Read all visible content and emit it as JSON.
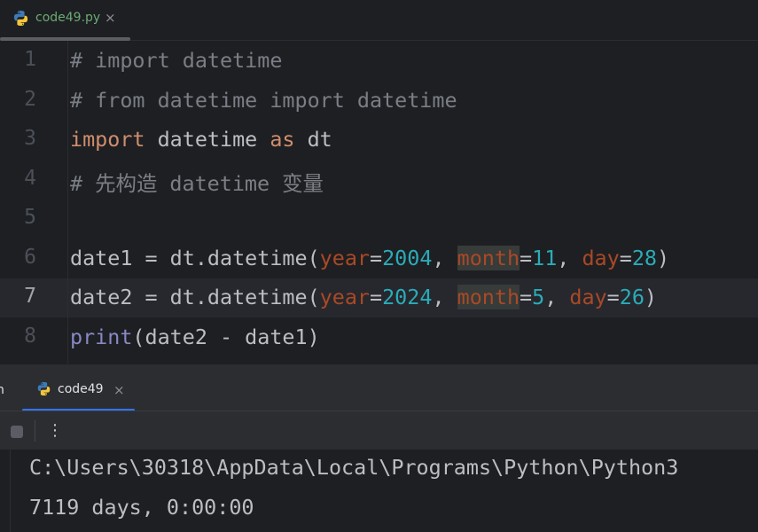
{
  "editor": {
    "tab": {
      "filename": "code49.py",
      "close": "×"
    },
    "lines": [
      {
        "num": "1",
        "tokens": [
          {
            "t": "# import datetime",
            "c": "comment"
          }
        ]
      },
      {
        "num": "2",
        "tokens": [
          {
            "t": "# from datetime import datetime",
            "c": "comment"
          }
        ]
      },
      {
        "num": "3",
        "tokens": [
          {
            "t": "import",
            "c": "kw"
          },
          {
            "t": " datetime ",
            "c": "plain"
          },
          {
            "t": "as",
            "c": "kw"
          },
          {
            "t": " dt",
            "c": "plain"
          }
        ]
      },
      {
        "num": "4",
        "tokens": [
          {
            "t": "# 先构造 datetime 变量",
            "c": "comment"
          }
        ]
      },
      {
        "num": "5",
        "tokens": []
      },
      {
        "num": "6",
        "tokens": [
          {
            "t": "date1 = dt.datetime(",
            "c": "plain"
          },
          {
            "t": "year",
            "c": "param"
          },
          {
            "t": "=",
            "c": "plain"
          },
          {
            "t": "2004",
            "c": "num"
          },
          {
            "t": ", ",
            "c": "plain"
          },
          {
            "t": "month",
            "c": "param",
            "hl": true
          },
          {
            "t": "=",
            "c": "plain"
          },
          {
            "t": "11",
            "c": "num"
          },
          {
            "t": ", ",
            "c": "plain"
          },
          {
            "t": "day",
            "c": "param"
          },
          {
            "t": "=",
            "c": "plain"
          },
          {
            "t": "28",
            "c": "num"
          },
          {
            "t": ")",
            "c": "plain"
          }
        ]
      },
      {
        "num": "7",
        "current": true,
        "tokens": [
          {
            "t": "date2 = dt.datetime(",
            "c": "plain"
          },
          {
            "t": "year",
            "c": "param"
          },
          {
            "t": "=",
            "c": "plain"
          },
          {
            "t": "2024",
            "c": "num"
          },
          {
            "t": ", ",
            "c": "plain"
          },
          {
            "t": "month",
            "c": "param",
            "hl": true
          },
          {
            "t": "=",
            "c": "plain"
          },
          {
            "t": "5",
            "c": "num"
          },
          {
            "t": ", ",
            "c": "plain"
          },
          {
            "t": "day",
            "c": "param"
          },
          {
            "t": "=",
            "c": "plain"
          },
          {
            "t": "26",
            "c": "num"
          },
          {
            "t": ")",
            "c": "plain"
          }
        ]
      },
      {
        "num": "8",
        "tokens": [
          {
            "t": "print",
            "c": "builtin"
          },
          {
            "t": "(date2 - date1)",
            "c": "plain"
          }
        ]
      }
    ]
  },
  "run_panel": {
    "cut_label": "n",
    "tab": {
      "name": "code49",
      "close": "×"
    },
    "toolbar": {
      "stop_icon": "stop-icon",
      "more_icon": "more-vertical-icon",
      "more_glyph": "⋮"
    },
    "output": [
      "C:\\Users\\30318\\AppData\\Local\\Programs\\Python\\Python3",
      "7119 days, 0:00:00"
    ]
  },
  "colors": {
    "background": "#1e1f22",
    "panel": "#2b2d30",
    "keyword": "#cf8e6d",
    "number": "#2aacb8",
    "param": "#aa4926",
    "comment": "#7a7e85",
    "builtin": "#8888c6",
    "text": "#bcbec4",
    "accent": "#3574f0",
    "tab_text": "#6aab73"
  }
}
